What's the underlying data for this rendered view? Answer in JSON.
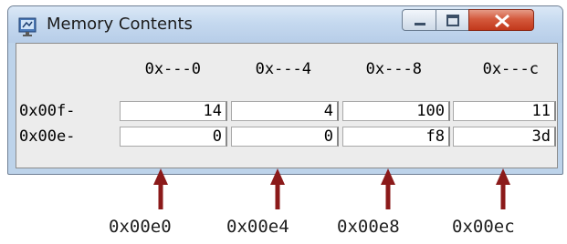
{
  "window": {
    "title": "Memory Contents",
    "controls": {
      "minimize": "minimize",
      "maximize": "maximize",
      "close": "close"
    }
  },
  "table": {
    "column_headers": [
      "0x---0",
      "0x---4",
      "0x---8",
      "0x---c"
    ],
    "rows": [
      {
        "label": "0x00f-",
        "values": [
          "14",
          "4",
          "100",
          "11"
        ]
      },
      {
        "label": "0x00e-",
        "values": [
          "0",
          "0",
          "f8",
          "3d"
        ]
      }
    ]
  },
  "annotations": {
    "addresses": [
      "0x00e0",
      "0x00e4",
      "0x00e8",
      "0x00ec"
    ],
    "arrow_color": "#8b1a1a"
  },
  "colors": {
    "titlebar": "#c5d9ef",
    "frame": "#bdd3ea",
    "close_button": "#c9452a"
  }
}
